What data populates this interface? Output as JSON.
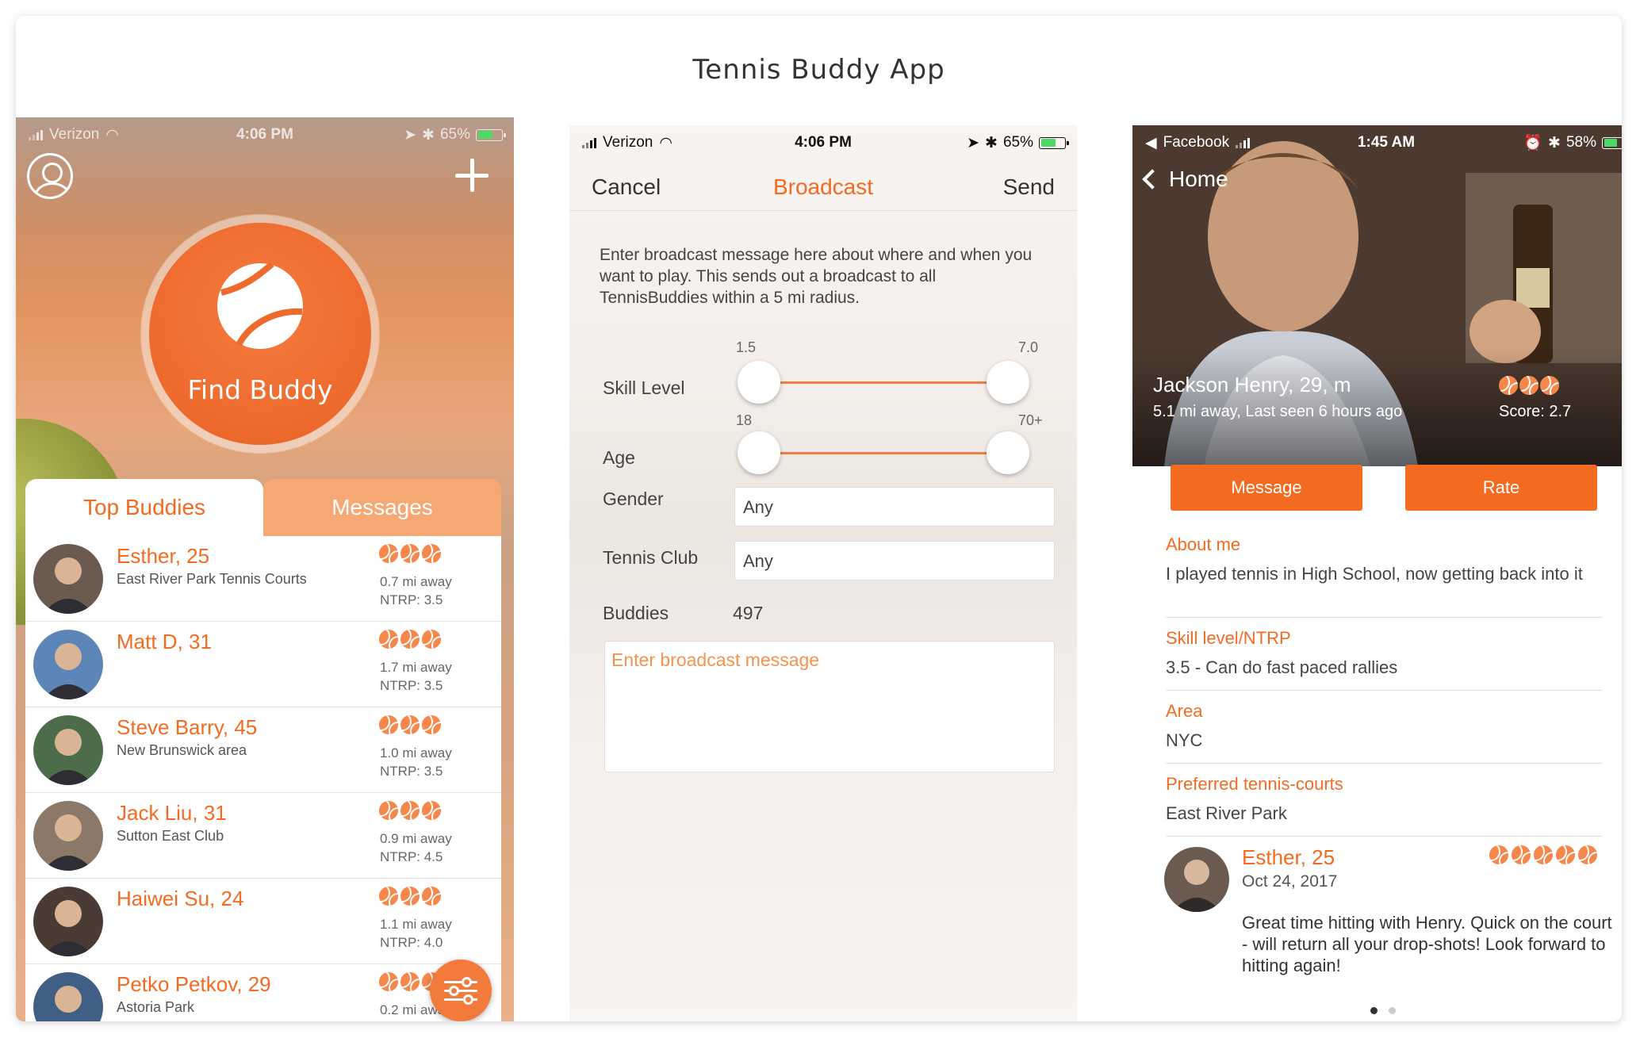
{
  "page": {
    "title": "Tennis Buddy App"
  },
  "screen_home": {
    "status": {
      "carrier": "Verizon",
      "time": "4:06 PM",
      "battery": "65%"
    },
    "find_button": "Find Buddy",
    "tabs": [
      {
        "label": "Top Buddies",
        "active": true
      },
      {
        "label": "Messages",
        "active": false
      }
    ],
    "buddies": [
      {
        "name": "Esther, 25",
        "place": "East River Park Tennis Courts",
        "distance": "0.7 mi away",
        "ntrp": "NTRP: 3.5",
        "avatar_color": "#6b5a50"
      },
      {
        "name": "Matt D, 31",
        "place": "",
        "distance": "1.7 mi away",
        "ntrp": "NTRP: 3.5",
        "avatar_color": "#5d86b8"
      },
      {
        "name": "Steve Barry, 45",
        "place": "New Brunswick area",
        "distance": "1.0 mi away",
        "ntrp": "NTRP: 3.5",
        "avatar_color": "#4d6d4a"
      },
      {
        "name": "Jack Liu, 31",
        "place": "Sutton East Club",
        "distance": "0.9 mi away",
        "ntrp": "NTRP: 4.5",
        "avatar_color": "#8c7868"
      },
      {
        "name": "Haiwei Su, 24",
        "place": "",
        "distance": "1.1 mi away",
        "ntrp": "NTRP: 4.0",
        "avatar_color": "#4a3b35"
      },
      {
        "name": "Petko Petkov, 29",
        "place": "Astoria Park",
        "distance": "0.2 mi away",
        "ntrp": "",
        "avatar_color": "#3f5f85"
      }
    ],
    "rating_balls": 3,
    "accent": "#f26b21"
  },
  "screen_broadcast": {
    "status": {
      "carrier": "Verizon",
      "time": "4:06 PM",
      "battery": "65%"
    },
    "nav": {
      "cancel": "Cancel",
      "title": "Broadcast",
      "send": "Send"
    },
    "description": "Enter broadcast message here about where and when you want to play. This sends out a broadcast to all TennisBuddies within a 5 mi radius.",
    "skill_level": {
      "label": "Skill Level",
      "min": "1.5",
      "max": "7.0"
    },
    "age": {
      "label": "Age",
      "min": "18",
      "max": "70+"
    },
    "gender": {
      "label": "Gender",
      "value": "Any"
    },
    "tennis_club": {
      "label": "Tennis Club",
      "value": "Any"
    },
    "buddies": {
      "label": "Buddies",
      "value": "497"
    },
    "message_placeholder": "Enter broadcast message"
  },
  "screen_profile": {
    "status": {
      "back_app": "Facebook",
      "time": "1:45 AM",
      "battery": "58%"
    },
    "back_label": "Home",
    "name": "Jackson Henry, 29, m",
    "meta": "5.1 mi away, Last seen 6 hours ago",
    "score": "Score: 2.7",
    "rating_balls": 3,
    "buttons": {
      "message": "Message",
      "rate": "Rate"
    },
    "about": {
      "heading": "About me",
      "value": "I played tennis in High School, now getting back into it"
    },
    "skill": {
      "heading": "Skill level/NTRP",
      "value": "3.5 - Can do fast paced rallies"
    },
    "area": {
      "heading": "Area",
      "value": "NYC"
    },
    "courts": {
      "heading": "Preferred tennis-courts",
      "value": "East River Park"
    },
    "review": {
      "name": "Esther, 25",
      "date": "Oct 24, 2017",
      "rating_balls": 5,
      "text": "Great time hitting with Henry. Quick on the court - will return all your drop-shots! Look forward to hitting again!"
    },
    "page_dots": {
      "count": 2,
      "active": 0
    }
  }
}
